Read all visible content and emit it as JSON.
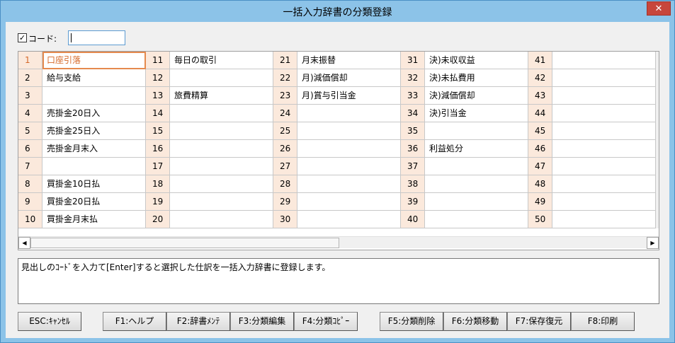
{
  "window": {
    "title": "一括入力辞書の分類登録",
    "close_label": "✕"
  },
  "code_filter": {
    "checked_mark": "✓",
    "label": "コード:",
    "value": ""
  },
  "columns": [
    {
      "rows": [
        {
          "num": "1",
          "name": "口座引落"
        },
        {
          "num": "2",
          "name": "給与支給"
        },
        {
          "num": "3",
          "name": ""
        },
        {
          "num": "4",
          "name": "売掛金20日入"
        },
        {
          "num": "5",
          "name": "売掛金25日入"
        },
        {
          "num": "6",
          "name": "売掛金月末入"
        },
        {
          "num": "7",
          "name": ""
        },
        {
          "num": "8",
          "name": "買掛金10日払"
        },
        {
          "num": "9",
          "name": "買掛金20日払"
        },
        {
          "num": "10",
          "name": "買掛金月末払"
        }
      ]
    },
    {
      "rows": [
        {
          "num": "11",
          "name": "毎日の取引"
        },
        {
          "num": "12",
          "name": ""
        },
        {
          "num": "13",
          "name": "旅費精算"
        },
        {
          "num": "14",
          "name": ""
        },
        {
          "num": "15",
          "name": ""
        },
        {
          "num": "16",
          "name": ""
        },
        {
          "num": "17",
          "name": ""
        },
        {
          "num": "18",
          "name": ""
        },
        {
          "num": "19",
          "name": ""
        },
        {
          "num": "20",
          "name": ""
        }
      ]
    },
    {
      "rows": [
        {
          "num": "21",
          "name": "月末振替"
        },
        {
          "num": "22",
          "name": "月)減価償却"
        },
        {
          "num": "23",
          "name": "月)賞与引当金"
        },
        {
          "num": "24",
          "name": ""
        },
        {
          "num": "25",
          "name": ""
        },
        {
          "num": "26",
          "name": ""
        },
        {
          "num": "27",
          "name": ""
        },
        {
          "num": "28",
          "name": ""
        },
        {
          "num": "29",
          "name": ""
        },
        {
          "num": "30",
          "name": ""
        }
      ]
    },
    {
      "rows": [
        {
          "num": "31",
          "name": "決)未収収益"
        },
        {
          "num": "32",
          "name": "決)未払費用"
        },
        {
          "num": "33",
          "name": "決)減価償却"
        },
        {
          "num": "34",
          "name": "決)引当金"
        },
        {
          "num": "35",
          "name": ""
        },
        {
          "num": "36",
          "name": "利益処分"
        },
        {
          "num": "37",
          "name": ""
        },
        {
          "num": "38",
          "name": ""
        },
        {
          "num": "39",
          "name": ""
        },
        {
          "num": "40",
          "name": ""
        }
      ]
    },
    {
      "rows": [
        {
          "num": "41",
          "name": ""
        },
        {
          "num": "42",
          "name": ""
        },
        {
          "num": "43",
          "name": ""
        },
        {
          "num": "44",
          "name": ""
        },
        {
          "num": "45",
          "name": ""
        },
        {
          "num": "46",
          "name": ""
        },
        {
          "num": "47",
          "name": ""
        },
        {
          "num": "48",
          "name": ""
        },
        {
          "num": "49",
          "name": ""
        },
        {
          "num": "50",
          "name": ""
        }
      ]
    }
  ],
  "selected": {
    "column": 0,
    "row": 0
  },
  "scrollbar": {
    "left_arrow": "◀",
    "right_arrow": "▶"
  },
  "message": "見出しのｺｰﾄﾞを入力て[Enter]すると選択した仕訳を一括入力辞書に登録します。",
  "buttons": [
    {
      "key": "esc",
      "label": "ESC:ｷｬﾝｾﾙ"
    },
    {
      "key": "f1",
      "label": "F1:ヘルプ"
    },
    {
      "key": "f2",
      "label": "F2:辞書ﾒﾝﾃ"
    },
    {
      "key": "f3",
      "label": "F3:分類編集"
    },
    {
      "key": "f4",
      "label": "F4:分類ｺﾋﾟｰ"
    },
    {
      "key": "f5",
      "label": "F5:分類削除"
    },
    {
      "key": "f6",
      "label": "F6:分類移動"
    },
    {
      "key": "f7",
      "label": "F7:保存復元"
    },
    {
      "key": "f8",
      "label": "F8:印刷"
    }
  ],
  "colors": {
    "title_bg": "#8cc3e8",
    "close_bg": "#c7463b",
    "num_bg": "#fbe9dc",
    "selected": "#d66a2a"
  }
}
